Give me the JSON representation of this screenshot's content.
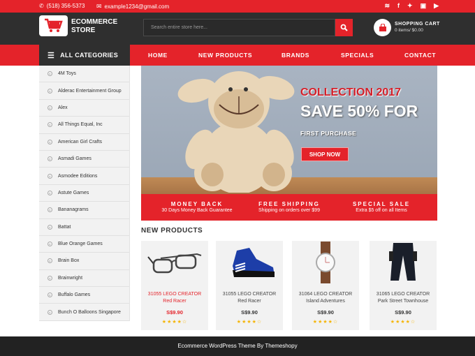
{
  "topbar": {
    "phone": "(518) 356-5373",
    "email": "example1234@gmail.com",
    "social": [
      "rss-icon",
      "facebook-icon",
      "twitter-icon",
      "instagram-icon",
      "youtube-icon"
    ]
  },
  "header": {
    "logo_line1": "ECOMMERCE",
    "logo_line2": "STORE",
    "search_placeholder": "Search entire store here...",
    "cart_title": "SHOPPING CART",
    "cart_sub": "0 items/ $0.00"
  },
  "nav": {
    "all_categories": "ALL CATEGORIES",
    "items": [
      "HOME",
      "NEW PRODUCTS",
      "BRANDS",
      "SPECIALS",
      "CONTACT"
    ]
  },
  "sidebar": {
    "items": [
      "4M Toys",
      "Alderac Entertainment Group",
      "Alex",
      "All Things Equal, Inc",
      "American Girl Crafts",
      "Asmadi Games",
      "Asmodee Editions",
      "Astute Games",
      "Bananagrams",
      "Battat",
      "Blue Orange Games",
      "Brain Box",
      "Brainwright",
      "Buffalo Games",
      "Bunch O Balloons Singapore"
    ]
  },
  "banner": {
    "title1": "COLLECTION 2017",
    "title2": "SAVE 50% FOR",
    "subtitle": "FIRST PURCHASE",
    "button": "SHOP NOW"
  },
  "features": [
    {
      "title": "MONEY BACK",
      "sub": "30 Days Money Back Guarantee"
    },
    {
      "title": "FREE SHIPPING",
      "sub": "Shipping on orders over $99"
    },
    {
      "title": "SPECIAL SALE",
      "sub": "Extra $5 off on all Items"
    }
  ],
  "new_products": {
    "title": "NEW PRODUCTS",
    "items": [
      {
        "name1": "31055 LEGO CREATOR",
        "name2": "Red Racer",
        "price": "S$9.90",
        "rating": 4,
        "image": "glasses"
      },
      {
        "name1": "31055 LEGO CREATOR",
        "name2": "Red Racer",
        "price": "S$9.90",
        "rating": 4,
        "image": "sneaker"
      },
      {
        "name1": "31064 LEGO CREATOR",
        "name2": "Island Adventures",
        "price": "S$9.90",
        "rating": 4,
        "image": "watch"
      },
      {
        "name1": "31065 LEGO CREATOR",
        "name2": "Park Street Townhouse",
        "price": "S$9.90",
        "rating": 4,
        "image": "trousers"
      }
    ]
  },
  "footer": {
    "text": "Ecommerce WordPress Theme By Themeshopy"
  },
  "colors": {
    "accent": "#e4232a",
    "dark": "#2f2f2f",
    "footer": "#222222",
    "star": "#f5b400"
  }
}
